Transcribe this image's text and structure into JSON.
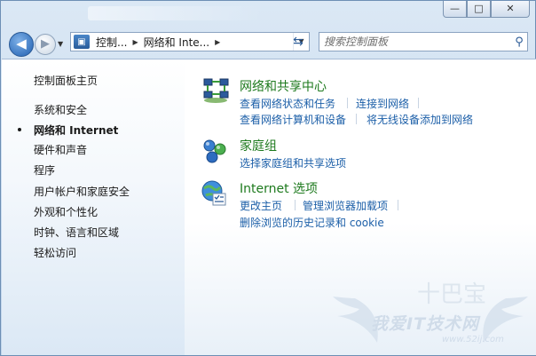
{
  "window": {
    "caption_buttons": {
      "minimize": "—",
      "maximize": "□",
      "close": "✕"
    }
  },
  "toolbar": {
    "back_icon": "arrow-left",
    "forward_icon": "arrow-right",
    "breadcrumb": [
      "控制...",
      "网络和 Inte..."
    ],
    "refresh_icon": "refresh",
    "search_placeholder": "搜索控制面板"
  },
  "sidebar": {
    "items": [
      {
        "label": "控制面板主页",
        "current": false
      },
      {
        "label": "系统和安全",
        "current": false
      },
      {
        "label": "网络和 Internet",
        "current": true
      },
      {
        "label": "硬件和声音",
        "current": false
      },
      {
        "label": "程序",
        "current": false
      },
      {
        "label": "用户帐户和家庭安全",
        "current": false
      },
      {
        "label": "外观和个性化",
        "current": false
      },
      {
        "label": "时钟、语言和区域",
        "current": false
      },
      {
        "label": "轻松访问",
        "current": false
      }
    ]
  },
  "categories": [
    {
      "title": "网络和共享中心",
      "icon": "network-center-icon",
      "links": [
        "查看网络状态和任务",
        "连接到网络",
        "查看网络计算机和设备",
        "将无线设备添加到网络"
      ]
    },
    {
      "title": "家庭组",
      "icon": "homegroup-icon",
      "links": [
        "选择家庭组和共享选项"
      ]
    },
    {
      "title": "Internet 选项",
      "icon": "internet-options-icon",
      "links": [
        "更改主页",
        "管理浏览器加载项",
        "删除浏览的历史记录和 cookie"
      ]
    }
  ],
  "watermark": {
    "text": "我爱IT技术网",
    "url": "www.52ij.com"
  },
  "colors": {
    "link": "#1c5fa8",
    "category_title": "#1e7a1e"
  }
}
